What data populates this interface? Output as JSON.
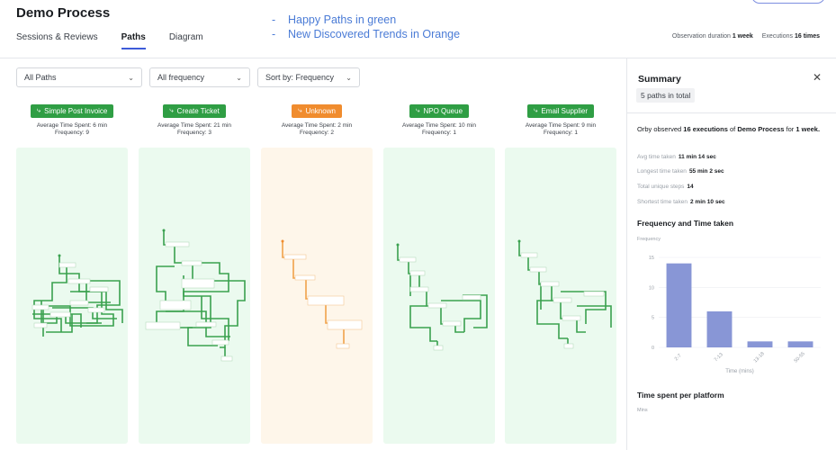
{
  "header": {
    "title": "Demo Process",
    "tabs": [
      {
        "label": "Sessions & Reviews",
        "active": false
      },
      {
        "label": "Paths",
        "active": true
      },
      {
        "label": "Diagram",
        "active": false
      }
    ],
    "notes": [
      "Happy Paths in green",
      "New Discovered Trends in Orange"
    ],
    "observation_label": "Observation duration",
    "observation_value": "1 week",
    "executions_label": "Executions",
    "executions_value": "16 times"
  },
  "filters": {
    "paths": "All Paths",
    "frequency": "All frequency",
    "sort": "Sort by: Frequency"
  },
  "paths": [
    {
      "name": "Simple Post Invoice",
      "time": "Average Time Spent: 6 min",
      "frequency": "Frequency: 9",
      "color": "#2f9e44"
    },
    {
      "name": "Create Ticket",
      "time": "Average Time Spent: 21 min",
      "frequency": "Frequency: 3",
      "color": "#2f9e44"
    },
    {
      "name": "Unknown",
      "time": "Average Time Spent: 2 min",
      "frequency": "Frequency: 2",
      "color": "#f08c2e"
    },
    {
      "name": "NPO Queue",
      "time": "Average Time Spent: 10 min",
      "frequency": "Frequency: 1",
      "color": "#2f9e44"
    },
    {
      "name": "Email Supplier",
      "time": "Average Time Spent: 9 min",
      "frequency": "Frequency: 1",
      "color": "#2f9e44"
    }
  ],
  "summary": {
    "title": "Summary",
    "paths_total": "5 paths in total",
    "observed_prefix": "Orby observed ",
    "observed_count": "16 executions",
    "observed_mid": " of ",
    "observed_process": "Demo Process",
    "observed_suffix": " for ",
    "observed_period": "1 week.",
    "stats": [
      {
        "label": "Avg time taken",
        "value": "11 min 14 sec"
      },
      {
        "label": "Longest time taken",
        "value": "55 min 2 sec"
      },
      {
        "label": "Total unique steps",
        "value": "14"
      },
      {
        "label": "Shortest time taken",
        "value": "2 min 10 sec"
      }
    ],
    "freq_heading": "Frequency and Time taken",
    "freq_axis_label": "Frequency",
    "platform_heading": "Time spent per platform",
    "platform_axis_label": "Mins"
  },
  "chart_data": {
    "type": "bar",
    "categories": [
      "2-7",
      "7-13",
      "13-18",
      "50-55"
    ],
    "values": [
      14,
      6,
      1,
      1
    ],
    "xlabel": "Time (mins)",
    "ylabel": "Frequency",
    "yticks": [
      0,
      5,
      10,
      15
    ],
    "ylim": [
      0,
      15
    ],
    "color": "#8896d6"
  }
}
